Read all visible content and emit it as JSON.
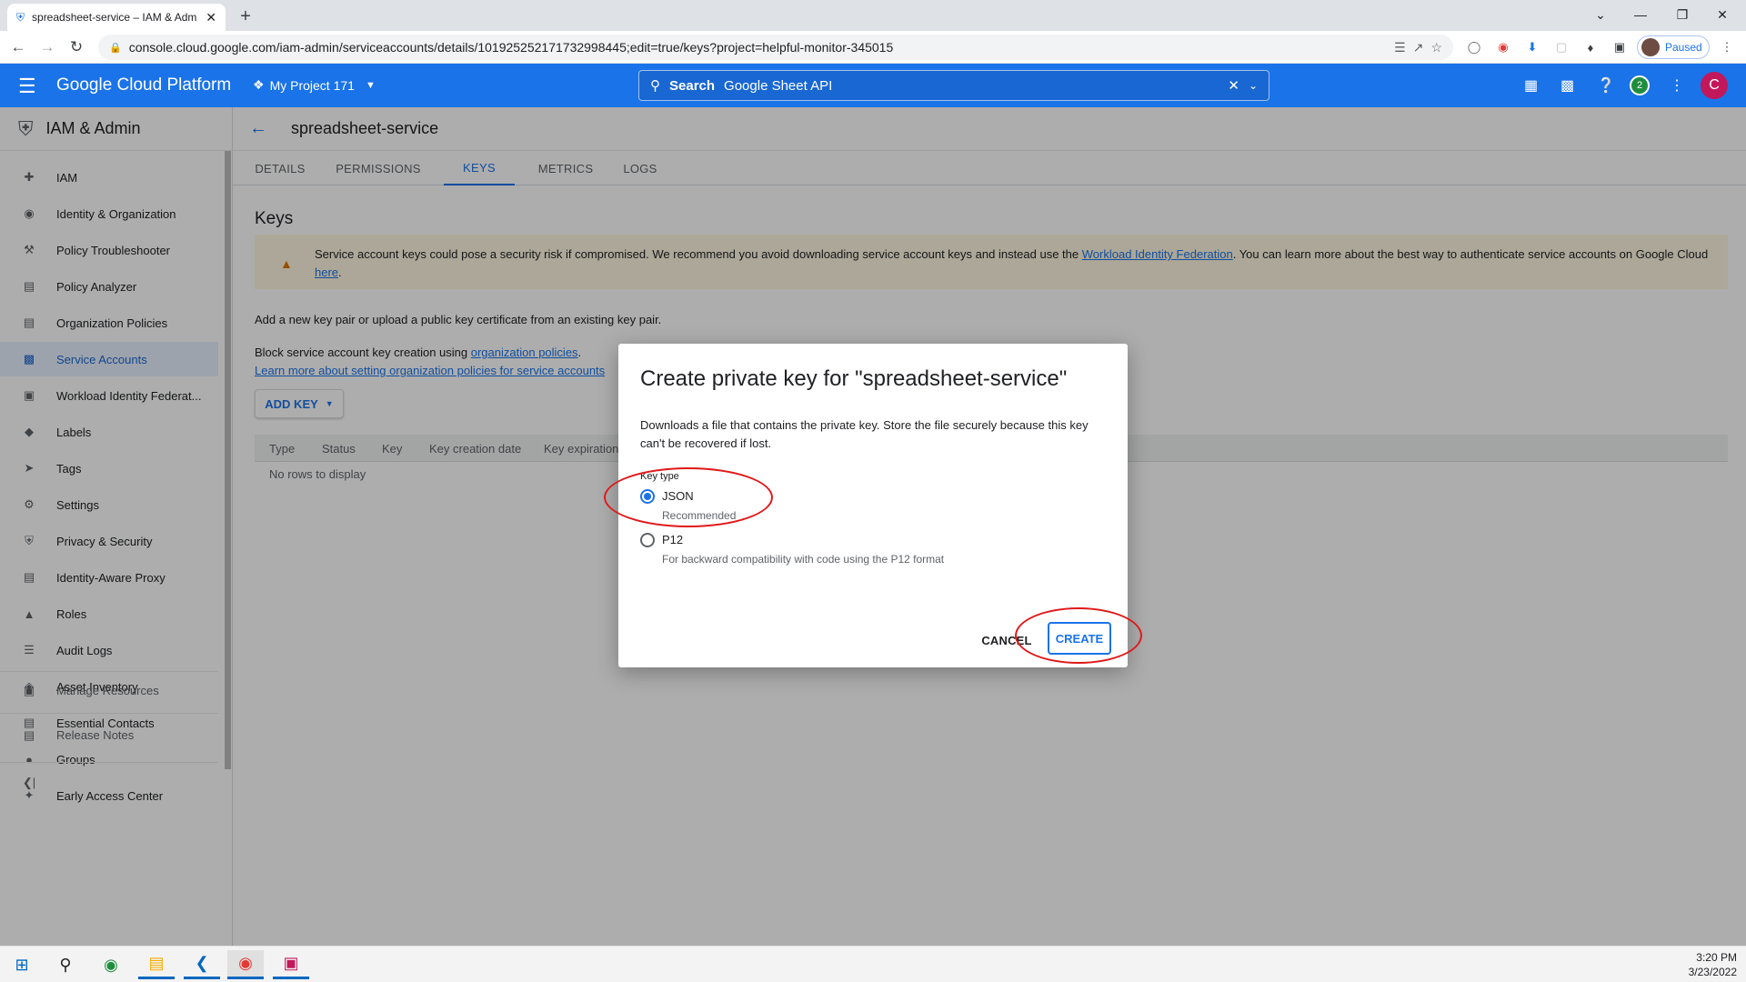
{
  "browser": {
    "tab_title": "spreadsheet-service – IAM & Adm",
    "url": "console.cloud.google.com/iam-admin/serviceaccounts/details/101925252171732998445;edit=true/keys?project=helpful-monitor-345015",
    "profile_status": "Paused"
  },
  "gcp": {
    "brand": "Google Cloud Platform",
    "project": "My Project 171",
    "search_label": "Search",
    "search_value": "Google Sheet API",
    "notifications": "2",
    "avatar_letter": "C"
  },
  "sidebar": {
    "title": "IAM & Admin",
    "items": [
      {
        "label": "IAM",
        "icon": "person-add-icon"
      },
      {
        "label": "Identity & Organization",
        "icon": "account-circle-icon"
      },
      {
        "label": "Policy Troubleshooter",
        "icon": "wrench-icon"
      },
      {
        "label": "Policy Analyzer",
        "icon": "document-search-icon"
      },
      {
        "label": "Organization Policies",
        "icon": "list-doc-icon"
      },
      {
        "label": "Service Accounts",
        "icon": "service-account-icon"
      },
      {
        "label": "Workload Identity Federat...",
        "icon": "id-card-icon"
      },
      {
        "label": "Labels",
        "icon": "tag-icon"
      },
      {
        "label": "Tags",
        "icon": "arrow-tag-icon"
      },
      {
        "label": "Settings",
        "icon": "gear-icon"
      },
      {
        "label": "Privacy & Security",
        "icon": "shield-icon"
      },
      {
        "label": "Identity-Aware Proxy",
        "icon": "proxy-icon"
      },
      {
        "label": "Roles",
        "icon": "hat-icon"
      },
      {
        "label": "Audit Logs",
        "icon": "lines-icon"
      },
      {
        "label": "Asset Inventory",
        "icon": "diamond-icon"
      },
      {
        "label": "Essential Contacts",
        "icon": "contacts-icon"
      },
      {
        "label": "Groups",
        "icon": "group-icon"
      },
      {
        "label": "Early Access Center",
        "icon": "sparkle-icon"
      }
    ],
    "manage_resources": "Manage Resources",
    "release_notes": "Release Notes"
  },
  "page": {
    "title": "spreadsheet-service",
    "tabs": [
      "DETAILS",
      "PERMISSIONS",
      "KEYS",
      "METRICS",
      "LOGS"
    ],
    "active_tab": "KEYS",
    "keys_heading": "Keys",
    "warning_text_1": "Service account keys could pose a security risk if compromised. We recommend you avoid downloading service account keys and instead use the",
    "warning_link_1": "Workload Identity Federation",
    "warning_text_2": ". You can learn more about the best way to authenticate service accounts on Google Cloud",
    "warning_link_2": "here",
    "warning_text_3": ".",
    "add_key_text": "Add a new key pair or upload a public key certificate from an existing key pair.",
    "block_text": "Block service account key creation using",
    "block_link": "organization policies",
    "block_end": ".",
    "learn_link": "Learn more about setting organization policies for service accounts",
    "add_key_button": "ADD KEY",
    "table_headers": [
      "Type",
      "Status",
      "Key",
      "Key creation date",
      "Key expiration date"
    ],
    "no_rows": "No rows to display"
  },
  "dialog": {
    "title": "Create private key for \"spreadsheet-service\"",
    "description": "Downloads a file that contains the private key. Store the file securely because this key can't be recovered if lost.",
    "key_type_label": "Key type",
    "options": [
      {
        "label": "JSON",
        "sub": "Recommended",
        "selected": true
      },
      {
        "label": "P12",
        "sub": "For backward compatibility with code using the P12 format",
        "selected": false
      }
    ],
    "cancel": "CANCEL",
    "create": "CREATE"
  },
  "taskbar": {
    "time": "3:20 PM",
    "date": "3/23/2022"
  },
  "colors": {
    "gcp_blue": "#1a73e8",
    "annotation_red": "#e01919",
    "warning_bg": "#fef7e0"
  }
}
